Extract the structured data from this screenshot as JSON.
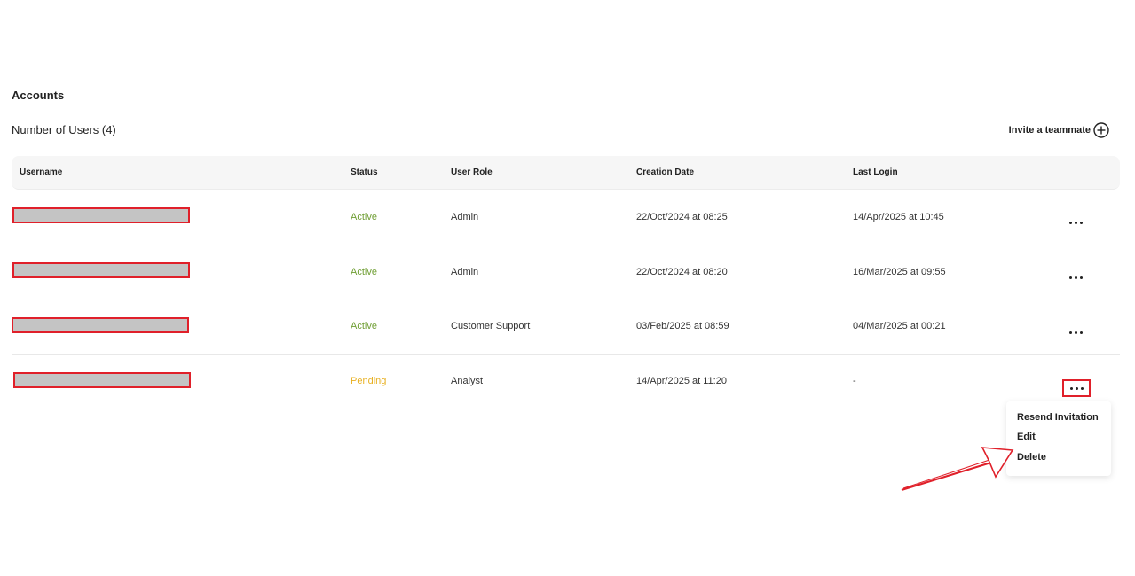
{
  "page": {
    "section_title": "Accounts",
    "user_count": "Number of Users (4)",
    "invite_label": "Invite a teammate"
  },
  "table": {
    "headers": {
      "username": "Username",
      "status": "Status",
      "role": "User Role",
      "created": "Creation Date",
      "last_login": "Last Login"
    },
    "rows": [
      {
        "status": "Active",
        "role": "Admin",
        "created": "22/Oct/2024 at 08:25",
        "last_login": "14/Apr/2025 at 10:45"
      },
      {
        "status": "Active",
        "role": "Admin",
        "created": "22/Oct/2024 at 08:20",
        "last_login": "16/Mar/2025 at 09:55"
      },
      {
        "status": "Active",
        "role": "Customer Support",
        "created": "03/Feb/2025 at 08:59",
        "last_login": "04/Mar/2025 at 00:21"
      },
      {
        "status": "Pending",
        "role": "Analyst",
        "created": "14/Apr/2025 at 11:20",
        "last_login": "-"
      }
    ]
  },
  "menu": {
    "resend": "Resend Invitation",
    "edit": "Edit",
    "delete": "Delete"
  },
  "colors": {
    "active": "#6f9e33",
    "pending": "#e8b020",
    "annotation": "#e0202a"
  },
  "icons": {
    "invite": "plus-circle-icon",
    "more": "more-horizontal-icon"
  }
}
